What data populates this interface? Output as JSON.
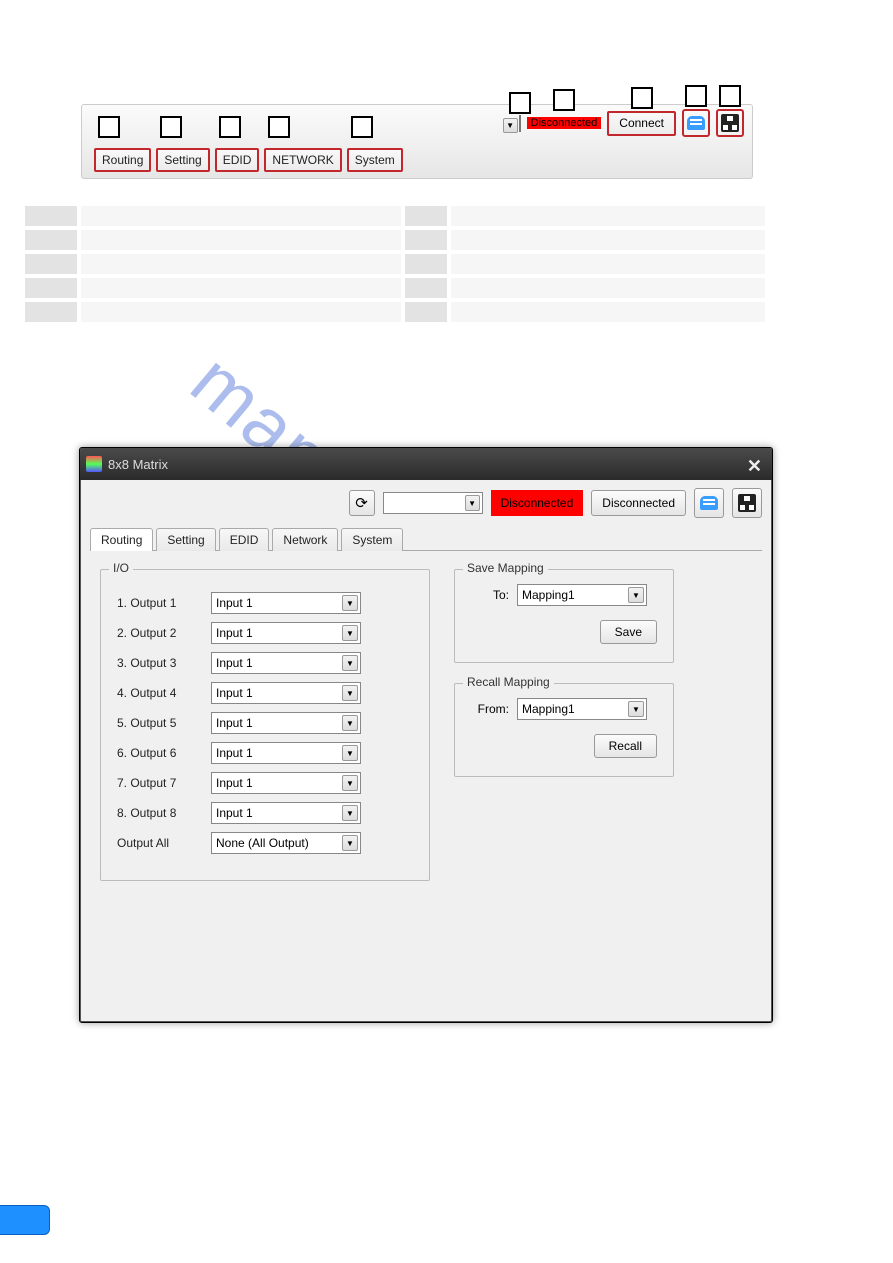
{
  "top_panel": {
    "tabs": [
      "Routing",
      "Setting",
      "EDID",
      "NETWORK",
      "System"
    ],
    "status_badge": "Disconnected",
    "connect_label": "Connect"
  },
  "window": {
    "title": "8x8 Matrix",
    "status_badge": "Disconnected",
    "disconnect_btn": "Disconnected",
    "tabs": [
      "Routing",
      "Setting",
      "EDID",
      "Network",
      "System"
    ],
    "active_tab": 0,
    "io": {
      "legend": "I/O",
      "rows": [
        {
          "label": "1. Output 1",
          "value": "Input 1"
        },
        {
          "label": "2. Output 2",
          "value": "Input 1"
        },
        {
          "label": "3. Output 3",
          "value": "Input 1"
        },
        {
          "label": "4. Output 4",
          "value": "Input 1"
        },
        {
          "label": "5. Output 5",
          "value": "Input 1"
        },
        {
          "label": "6. Output 6",
          "value": "Input 1"
        },
        {
          "label": "7. Output 7",
          "value": "Input 1"
        },
        {
          "label": "8. Output 8",
          "value": "Input 1"
        },
        {
          "label": "Output All",
          "value": "None (All Output)"
        }
      ]
    },
    "save_mapping": {
      "legend": "Save Mapping",
      "to_label": "To:",
      "to_value": "Mapping1",
      "button": "Save"
    },
    "recall_mapping": {
      "legend": "Recall Mapping",
      "from_label": "From:",
      "from_value": "Mapping1",
      "button": "Recall"
    }
  }
}
